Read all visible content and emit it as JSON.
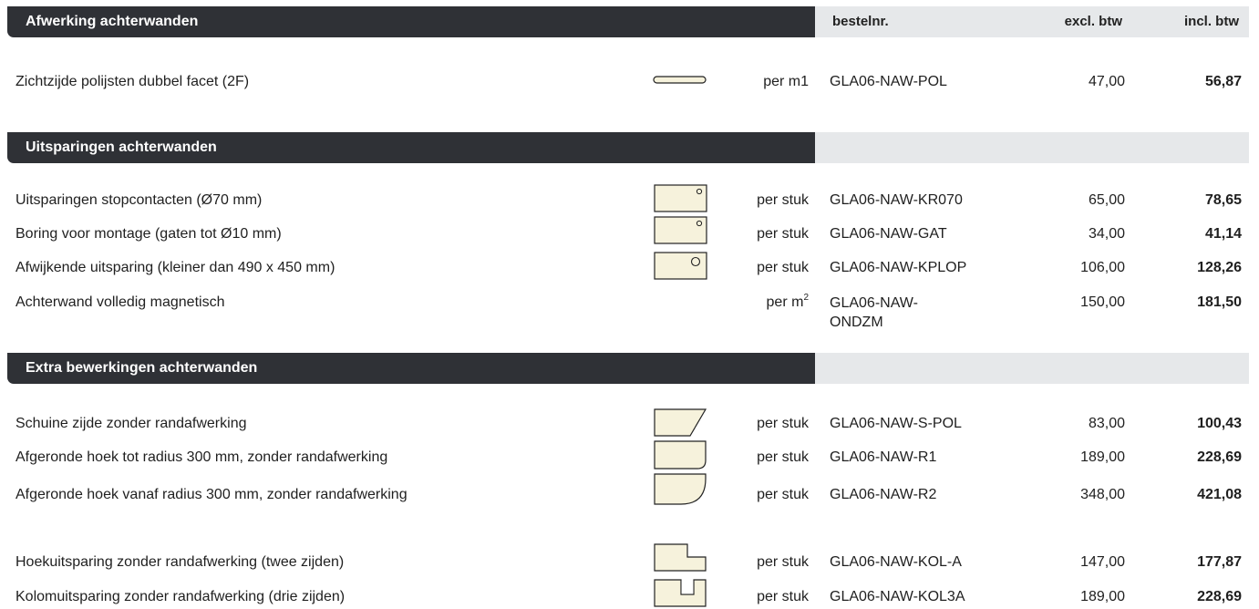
{
  "header": {
    "title": "Afwerking achterwanden",
    "col_code": "bestelnr.",
    "col_excl": "excl. btw",
    "col_incl": "incl. btw"
  },
  "section2": {
    "title": "Uitsparingen achterwanden"
  },
  "section3": {
    "title": "Extra bewerkingen achterwanden"
  },
  "rows": [
    {
      "desc": "Zichtzijde polijsten dubbel facet (2F)",
      "unit": "per m1",
      "code": "GLA06-NAW-POL",
      "excl": "47,00",
      "incl": "56,87",
      "icon": "edge-strip-icon"
    },
    {
      "desc": "Uitsparingen stopcontacten (Ø70 mm)",
      "unit": "per stuk",
      "code": "GLA06-NAW-KR070",
      "excl": "65,00",
      "incl": "78,65",
      "icon": "panel-small-hole-icon"
    },
    {
      "desc": "Boring voor montage (gaten tot Ø10 mm)",
      "unit": "per stuk",
      "code": "GLA06-NAW-GAT",
      "excl": "34,00",
      "incl": "41,14",
      "icon": "panel-small-hole-icon"
    },
    {
      "desc": "Afwijkende uitsparing (kleiner dan 490 x 450 mm)",
      "unit": "per stuk",
      "code": "GLA06-NAW-KPLOP",
      "excl": "106,00",
      "incl": "128,26",
      "icon": "panel-large-hole-icon"
    },
    {
      "desc": "Achterwand volledig magnetisch",
      "unit": "per m",
      "unit_sup": "2",
      "code": "GLA06-NAW-ONDZM",
      "excl": "150,00",
      "incl": "181,50"
    },
    {
      "desc": "Schuine zijde zonder randafwerking",
      "unit": "per stuk",
      "code": "GLA06-NAW-S-POL",
      "excl": "83,00",
      "incl": "100,43",
      "icon": "panel-slanted-corner-icon"
    },
    {
      "desc": "Afgeronde hoek tot radius 300 mm, zonder randafwerking",
      "unit": "per stuk",
      "code": "GLA06-NAW-R1",
      "excl": "189,00",
      "incl": "228,69",
      "icon": "panel-small-radius-icon"
    },
    {
      "desc": "Afgeronde hoek vanaf radius 300 mm, zonder randafwerking",
      "unit": "per stuk",
      "code": "GLA06-NAW-R2",
      "excl": "348,00",
      "incl": "421,08",
      "icon": "panel-large-radius-icon"
    },
    {
      "desc": "Hoekuitsparing zonder randafwerking (twee zijden)",
      "unit": "per stuk",
      "code": "GLA06-NAW-KOL-A",
      "excl": "147,00",
      "incl": "177,87",
      "icon": "panel-corner-notch-icon"
    },
    {
      "desc": "Kolomuitsparing zonder randafwerking (drie zijden)",
      "unit": "per stuk",
      "code": "GLA06-NAW-KOL3A",
      "excl": "189,00",
      "incl": "228,69",
      "icon": "panel-column-notch-icon"
    }
  ],
  "colors": {
    "header_bg": "#2f3136",
    "header_light_bg": "#e6e8ea",
    "icon_fill": "#f6f2dc"
  }
}
